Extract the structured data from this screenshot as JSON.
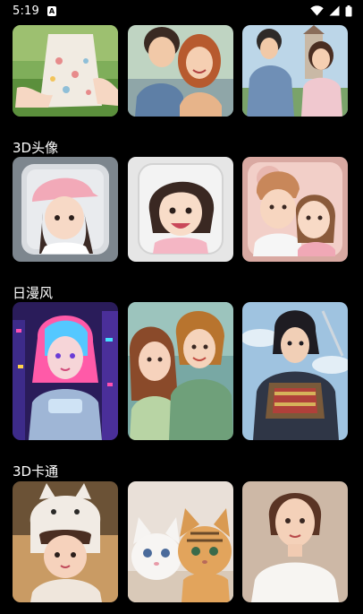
{
  "status_bar": {
    "time": "5:19",
    "notification_icon": "A",
    "icons": [
      "wifi-icon",
      "signal-icon",
      "battery-icon"
    ]
  },
  "sections": [
    {
      "title": "",
      "cards": [
        "girl-on-grass",
        "couple-smiling",
        "family-castle"
      ]
    },
    {
      "title": "3D头像",
      "cards": [
        "3d-girl-pink-cap",
        "3d-girl-bob-smile",
        "3d-couple-pink"
      ]
    },
    {
      "title": "日漫风",
      "cards": [
        "anime-cyber-girl",
        "anime-couple",
        "anime-samurai"
      ]
    },
    {
      "title": "3D卡通",
      "cards": [
        "3d-girl-cat-hat",
        "3d-kittens",
        "3d-woman-white-shirt"
      ]
    }
  ],
  "colors": {
    "background": "#000000",
    "text": "#ffffff"
  }
}
